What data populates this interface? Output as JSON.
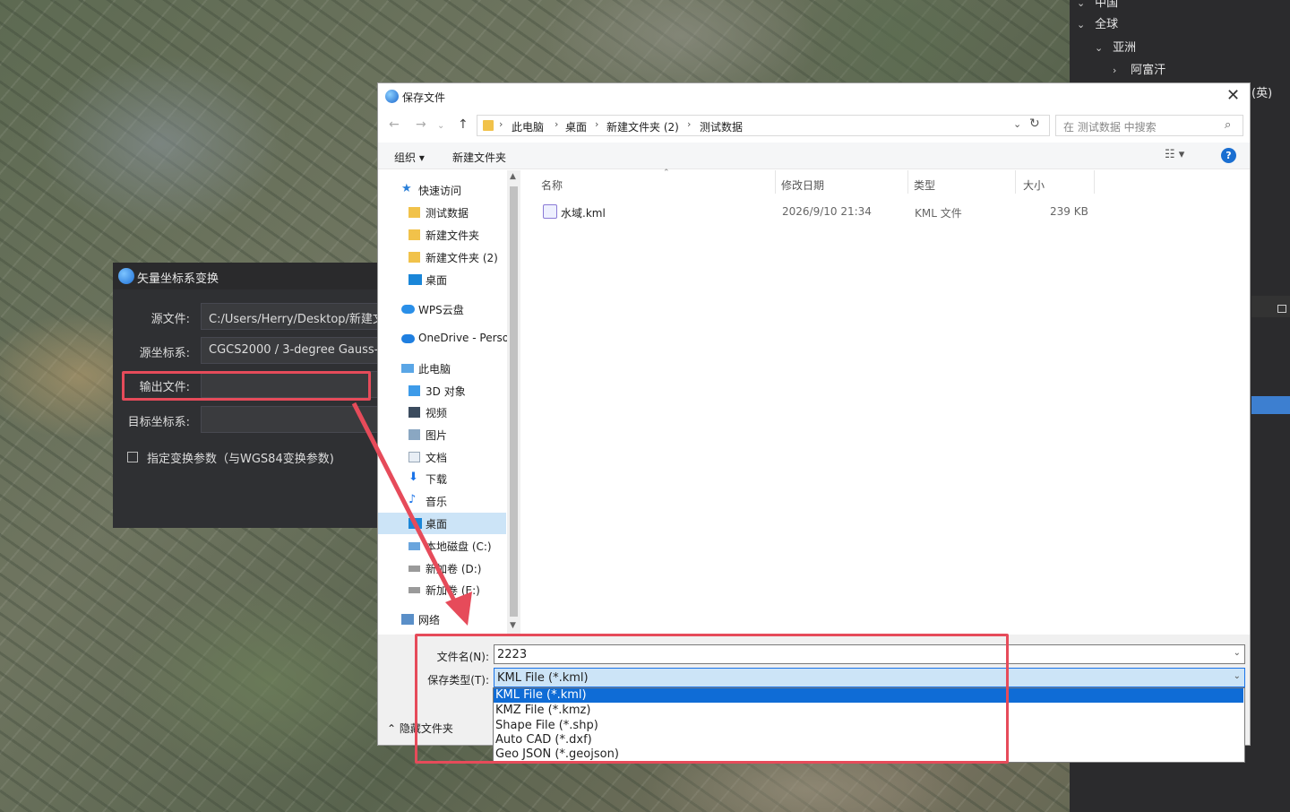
{
  "right_panel": {
    "items": [
      {
        "label": "中国"
      },
      {
        "label": "全球"
      },
      {
        "label": "亚洲"
      },
      {
        "label": "阿富汗"
      }
    ],
    "suffix": "(英)"
  },
  "convert_dialog": {
    "title": "矢量坐标系变换",
    "fields": [
      {
        "label": "源文件:",
        "value": "C:/Users/Herry/Desktop/新建文件夹"
      },
      {
        "label": "源坐标系:",
        "value": "CGCS2000 / 3-degree Gauss-Kruger"
      },
      {
        "label": "输出文件:",
        "value": ""
      },
      {
        "label": "目标坐标系:",
        "value": ""
      }
    ],
    "checkbox_label": "指定变换参数（与WGS84变换参数)"
  },
  "save_dialog": {
    "title": "保存文件",
    "breadcrumb": [
      "此电脑",
      "桌面",
      "新建文件夹 (2)",
      "测试数据"
    ],
    "search_placeholder": "在 测试数据 中搜索",
    "toolbar": {
      "organize": "组织 ▾",
      "new_folder": "新建文件夹"
    },
    "nav": [
      {
        "label": "快速访问",
        "icon": "star-icon"
      },
      {
        "label": "测试数据",
        "icon": "folder-icon"
      },
      {
        "label": "新建文件夹",
        "icon": "folder-icon"
      },
      {
        "label": "新建文件夹 (2)",
        "icon": "folder-icon"
      },
      {
        "label": "桌面",
        "icon": "desktop-icon"
      },
      {
        "label": "WPS云盘",
        "icon": "cloud-icon"
      },
      {
        "label": "OneDrive - Personal",
        "icon": "onedrive-icon"
      },
      {
        "label": "此电脑",
        "icon": "pc-icon"
      },
      {
        "label": "3D 对象",
        "icon": "cube-icon"
      },
      {
        "label": "视频",
        "icon": "video-icon"
      },
      {
        "label": "图片",
        "icon": "picture-icon"
      },
      {
        "label": "文档",
        "icon": "document-icon"
      },
      {
        "label": "下载",
        "icon": "download-icon"
      },
      {
        "label": "音乐",
        "icon": "music-icon"
      },
      {
        "label": "桌面",
        "icon": "desktop-icon"
      },
      {
        "label": "本地磁盘 (C:)",
        "icon": "drive-icon"
      },
      {
        "label": "新加卷 (D:)",
        "icon": "drive-icon"
      },
      {
        "label": "新加卷 (E:)",
        "icon": "drive-icon"
      },
      {
        "label": "网络",
        "icon": "network-icon"
      }
    ],
    "columns": [
      "名称",
      "修改日期",
      "类型",
      "大小"
    ],
    "files": [
      {
        "name": "水域.kml",
        "date": "2026/9/10 21:34",
        "type": "KML 文件",
        "size": "239 KB"
      }
    ],
    "filename_label": "文件名(N):",
    "filename_value": "2223",
    "filetype_label": "保存类型(T):",
    "filetype_value": "KML File (*.kml)",
    "filetype_options": [
      "KML File (*.kml)",
      "KMZ File (*.kmz)",
      "Shape File (*.shp)",
      "Auto CAD (*.dxf)",
      "Geo JSON (*.geojson)"
    ],
    "hide_folders": "隐藏文件夹"
  },
  "colors": {
    "highlight": "#e64b5a",
    "selection": "#0f6cd6"
  }
}
